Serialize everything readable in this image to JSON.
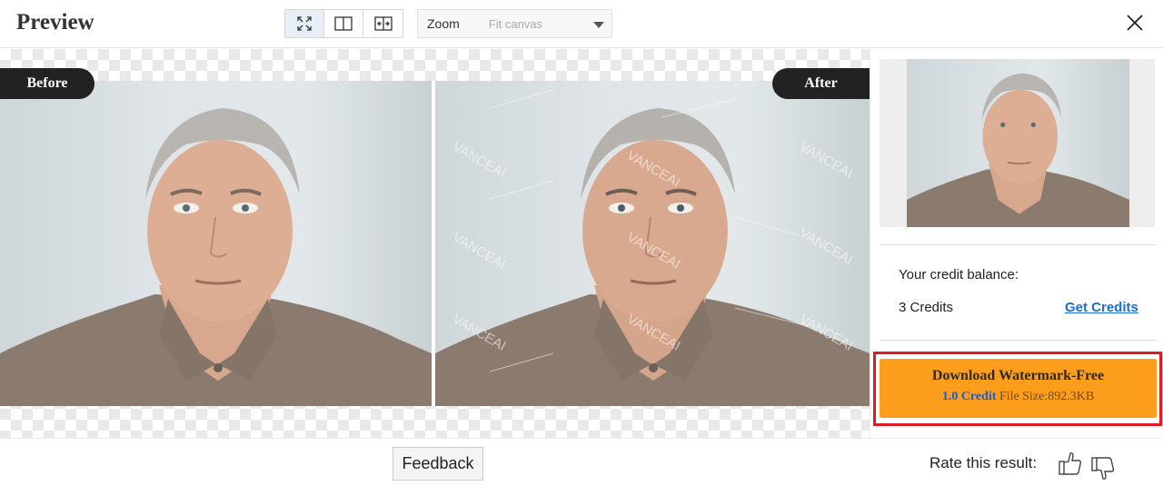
{
  "header": {
    "title": "Preview",
    "view_modes": [
      "fullscreen-icon",
      "split-view-icon",
      "slider-compare-icon"
    ],
    "zoom": {
      "label": "Zoom",
      "value": "Fit canvas"
    }
  },
  "canvas": {
    "before_label": "Before",
    "after_label": "After",
    "watermark_text": "VANCEAI"
  },
  "sidebar": {
    "credit_balance_label": "Your credit balance:",
    "credits": "3 Credits",
    "get_credits": "Get Credits",
    "download": {
      "title": "Download Watermark-Free",
      "credit_cost": "1.0 Credit",
      "file_size": "File Size:892.3KB"
    }
  },
  "footer": {
    "feedback": "Feedback",
    "rate_label": "Rate this result:"
  },
  "colors": {
    "accent_orange": "#fc9d1c",
    "link_blue": "#1a6fd1",
    "highlight_red": "#e01b24",
    "badge_dark": "#222222"
  }
}
